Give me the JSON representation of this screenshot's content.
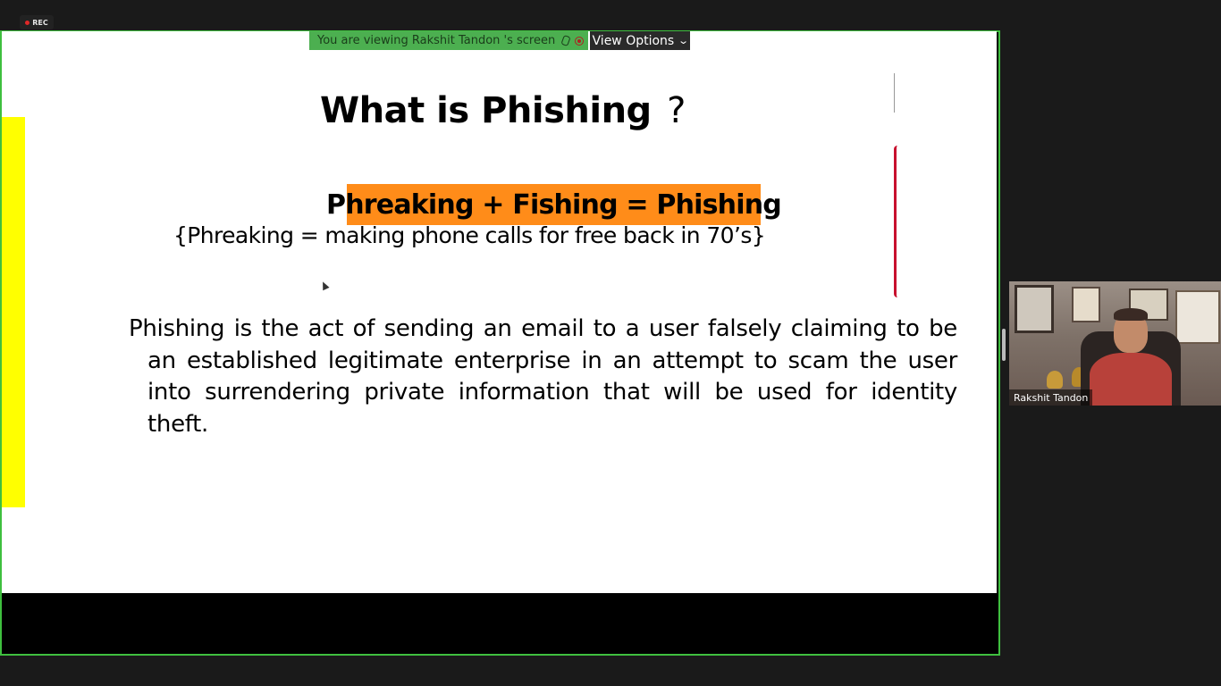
{
  "recording": {
    "label": "REC"
  },
  "banner": {
    "viewing_text": "You are viewing Rakshit Tandon 's screen",
    "view_options_label": "View Options",
    "view_options_icon": "chevron-down-icon"
  },
  "slide": {
    "title": "What is Phishing",
    "title_mark": "?",
    "highlight": "Phreaking + Fishing = Phishing",
    "subline": "{Phreaking = making phone calls for free back in 70’s}",
    "definition": "Phishing is the act of sending an email to a user falsely claiming to be an established legitimate enterprise in an attempt to scam the user into surrendering private information that will be used for identity theft."
  },
  "participant": {
    "name": "Rakshit Tandon"
  },
  "colors": {
    "share_border": "#3fbf3f",
    "banner_bg": "#4caf50",
    "highlight_bg": "#ff8c19",
    "slide_accent": "#ffff00",
    "background": "#1a1a1a"
  }
}
